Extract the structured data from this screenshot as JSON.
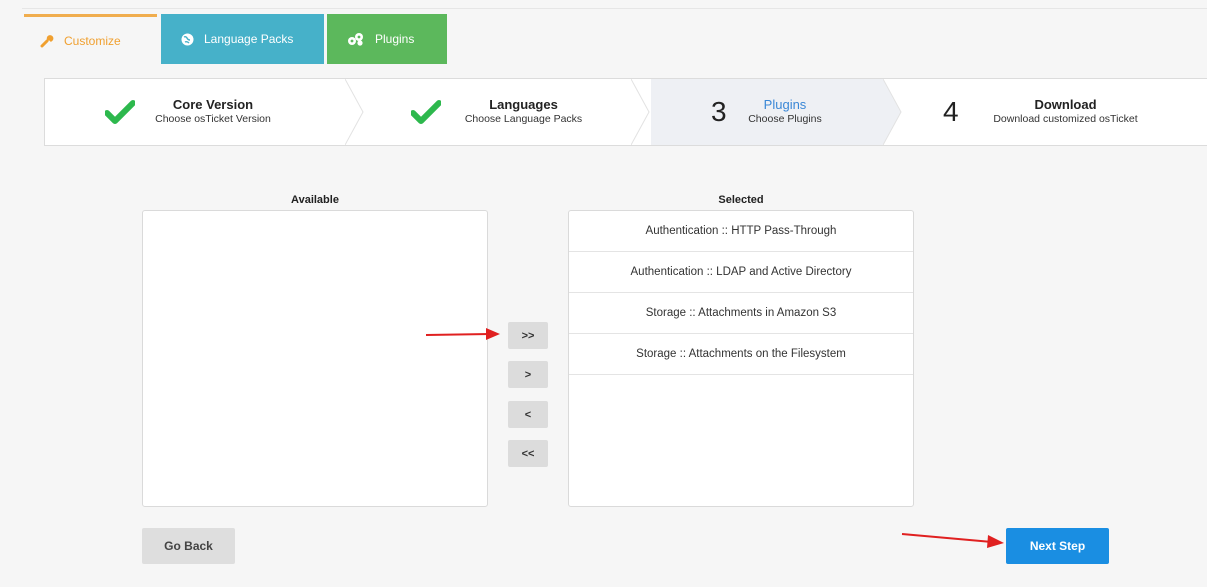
{
  "tabs": [
    {
      "label": "Customize",
      "icon": "wrench-icon"
    },
    {
      "label": "Language Packs",
      "icon": "globe-icon"
    },
    {
      "label": "Plugins",
      "icon": "puzzle-icon"
    }
  ],
  "steps": [
    {
      "title": "Core Version",
      "subtitle": "Choose osTicket Version",
      "status": "complete",
      "icon": "checkmark-icon"
    },
    {
      "title": "Languages",
      "subtitle": "Choose Language Packs",
      "status": "complete",
      "icon": "checkmark-icon"
    },
    {
      "number": "3",
      "title": "Plugins",
      "subtitle": "Choose Plugins",
      "status": "active"
    },
    {
      "number": "4",
      "title": "Download",
      "subtitle": "Download customized osTicket",
      "status": "pending"
    }
  ],
  "available": {
    "title": "Available",
    "items": []
  },
  "selected": {
    "title": "Selected",
    "items": [
      "Authentication :: HTTP Pass-Through",
      "Authentication :: LDAP and Active Directory",
      "Storage :: Attachments in Amazon S3",
      "Storage :: Attachments on the Filesystem"
    ]
  },
  "move_buttons": {
    "add_all": ">>",
    "add_one": ">",
    "remove_one": "<",
    "remove_all": "<<"
  },
  "actions": {
    "back": "Go Back",
    "next": "Next Step"
  },
  "colors": {
    "customize_accent": "#f0ad4e",
    "language_tab": "#46b1c9",
    "plugins_tab": "#5cb85c",
    "check_green": "#2db84d",
    "active_step_text": "#3a87d6",
    "primary_button": "#1a8ee2",
    "annotation_arrow": "#e02020"
  }
}
